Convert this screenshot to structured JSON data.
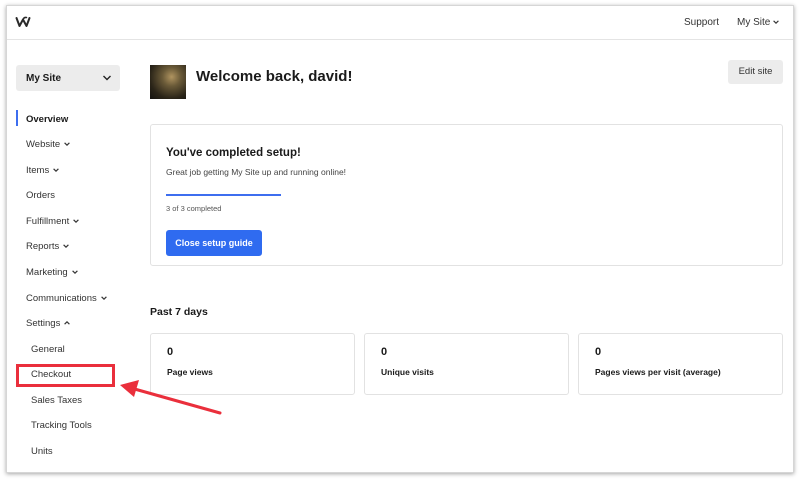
{
  "topbar": {
    "logo_icon": "weebly-logo-icon",
    "support_label": "Support",
    "site_menu_label": "My Site"
  },
  "sidebar": {
    "site_select_label": "My Site",
    "items": [
      {
        "label": "Overview",
        "active": true,
        "has_chevron": false
      },
      {
        "label": "Website",
        "has_chevron": true,
        "chevron": "down"
      },
      {
        "label": "Items",
        "has_chevron": true,
        "chevron": "down"
      },
      {
        "label": "Orders",
        "has_chevron": false
      },
      {
        "label": "Fulfillment",
        "has_chevron": true,
        "chevron": "down"
      },
      {
        "label": "Reports",
        "has_chevron": true,
        "chevron": "down"
      },
      {
        "label": "Marketing",
        "has_chevron": true,
        "chevron": "down"
      },
      {
        "label": "Communications",
        "has_chevron": true,
        "chevron": "down"
      },
      {
        "label": "Settings",
        "has_chevron": true,
        "chevron": "up"
      }
    ],
    "settings_subitems": [
      {
        "label": "General"
      },
      {
        "label": "Checkout",
        "highlighted": true
      },
      {
        "label": "Sales Taxes"
      },
      {
        "label": "Tracking Tools"
      },
      {
        "label": "Units"
      }
    ]
  },
  "main": {
    "welcome_text": "Welcome back, david!",
    "edit_site_label": "Edit site",
    "setup": {
      "title": "You've completed setup!",
      "subtitle": "Great job getting My Site up and running online!",
      "progress_fraction": 1.0,
      "progress_text": "3 of 3 completed",
      "close_button_label": "Close setup guide"
    },
    "past_title": "Past 7 days",
    "stats": [
      {
        "value": "0",
        "label": "Page views"
      },
      {
        "value": "0",
        "label": "Unique visits"
      },
      {
        "value": "0",
        "label": "Pages views per visit (average)"
      }
    ]
  },
  "colors": {
    "accent": "#2f6bf0",
    "active_indicator": "#3d6eef",
    "annotation_red": "#ea2f3c"
  }
}
